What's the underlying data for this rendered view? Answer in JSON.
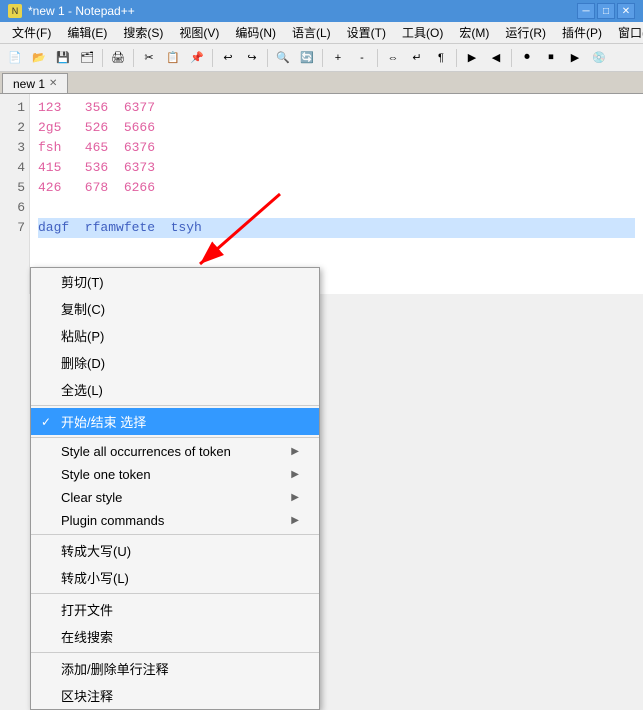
{
  "titleBar": {
    "title": "*new 1 - Notepad++",
    "icon": "N",
    "buttons": [
      "─",
      "□",
      "✕"
    ]
  },
  "menuBar": {
    "items": [
      "文件(F)",
      "编辑(E)",
      "搜索(S)",
      "视图(V)",
      "编码(N)",
      "语言(L)",
      "设置(T)",
      "工具(O)",
      "宏(M)",
      "运行(R)",
      "插件(P)",
      "窗口(W)"
    ]
  },
  "tabs": [
    {
      "label": "new 1",
      "active": true
    }
  ],
  "editor": {
    "lines": [
      {
        "num": "1",
        "content": "123   356  6377",
        "cols": [
          "pink",
          "pink",
          "pink"
        ]
      },
      {
        "num": "2",
        "content": "2g5   526  5666",
        "cols": [
          "pink",
          "pink",
          "pink"
        ]
      },
      {
        "num": "3",
        "content": "fsh   465  6376",
        "cols": [
          "pink",
          "pink",
          "pink"
        ]
      },
      {
        "num": "4",
        "content": "415   536  6373",
        "cols": [
          "pink",
          "pink",
          "pink"
        ]
      },
      {
        "num": "5",
        "content": "426   678  6266",
        "cols": [
          "pink",
          "pink",
          "pink"
        ]
      },
      {
        "num": "6",
        "content": "",
        "cols": []
      },
      {
        "num": "7",
        "content": "dagf  rfamwfete  tsyh",
        "cols": [
          "blue",
          "blue",
          "blue"
        ],
        "selected": true
      }
    ]
  },
  "contextMenu": {
    "items": [
      {
        "id": "cut",
        "label": "剪切(T)",
        "hasArrow": false,
        "separator": false,
        "disabled": false,
        "checked": false
      },
      {
        "id": "copy",
        "label": "复制(C)",
        "hasArrow": false,
        "separator": false,
        "disabled": false,
        "checked": false
      },
      {
        "id": "paste",
        "label": "粘贴(P)",
        "hasArrow": false,
        "separator": false,
        "disabled": false,
        "checked": false
      },
      {
        "id": "delete",
        "label": "删除(D)",
        "hasArrow": false,
        "separator": false,
        "disabled": false,
        "checked": false
      },
      {
        "id": "selectall",
        "label": "全选(L)",
        "hasArrow": false,
        "separator": true,
        "disabled": false,
        "checked": false
      },
      {
        "id": "begin-end-select",
        "label": "开始/结束 选择",
        "hasArrow": false,
        "separator": true,
        "disabled": false,
        "checked": true,
        "highlighted": true
      },
      {
        "id": "style-all",
        "label": "Style all occurrences of token",
        "hasArrow": true,
        "separator": false,
        "disabled": false,
        "checked": false
      },
      {
        "id": "style-one",
        "label": "Style one token",
        "hasArrow": true,
        "separator": false,
        "disabled": false,
        "checked": false
      },
      {
        "id": "clear-style",
        "label": "Clear style",
        "hasArrow": true,
        "separator": false,
        "disabled": false,
        "checked": false
      },
      {
        "id": "plugin-commands",
        "label": "Plugin commands",
        "hasArrow": true,
        "separator": true,
        "disabled": false,
        "checked": false
      },
      {
        "id": "uppercase",
        "label": "转成大写(U)",
        "hasArrow": false,
        "separator": false,
        "disabled": false,
        "checked": false
      },
      {
        "id": "lowercase",
        "label": "转成小写(L)",
        "hasArrow": false,
        "separator": true,
        "disabled": false,
        "checked": false
      },
      {
        "id": "open-file",
        "label": "打开文件",
        "hasArrow": false,
        "separator": false,
        "disabled": false,
        "checked": false
      },
      {
        "id": "online-search",
        "label": "在线搜索",
        "hasArrow": false,
        "separator": true,
        "disabled": false,
        "checked": false
      },
      {
        "id": "add-comment",
        "label": "添加/删除单行注释",
        "hasArrow": false,
        "separator": false,
        "disabled": false,
        "checked": false
      },
      {
        "id": "block-comment",
        "label": "区块注释",
        "hasArrow": false,
        "separator": false,
        "disabled": false,
        "checked": false
      }
    ]
  }
}
